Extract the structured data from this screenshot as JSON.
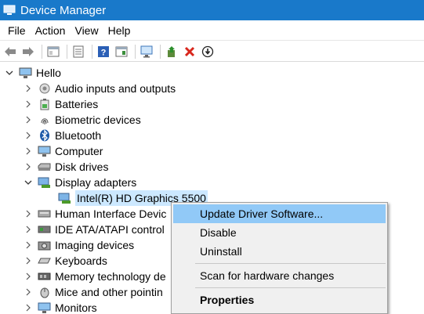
{
  "window": {
    "title": "Device Manager"
  },
  "menu": [
    "File",
    "Action",
    "View",
    "Help"
  ],
  "toolbar": [
    {
      "icon": "back-arrow-icon"
    },
    {
      "icon": "forward-arrow-icon"
    },
    {
      "icon": "show-hide-console-tree-icon"
    },
    {
      "icon": "properties-icon"
    },
    {
      "icon": "help-icon"
    },
    {
      "icon": "show-action-pane-icon"
    },
    {
      "icon": "scan-hardware-icon"
    },
    {
      "icon": "update-driver-icon"
    },
    {
      "icon": "uninstall-x-icon"
    },
    {
      "icon": "disable-device-icon"
    }
  ],
  "tree": {
    "root": "Hello",
    "categories": [
      {
        "label": "Audio inputs and outputs",
        "icon": "speaker-icon",
        "expanded": false
      },
      {
        "label": "Batteries",
        "icon": "battery-icon",
        "expanded": false
      },
      {
        "label": "Biometric devices",
        "icon": "fingerprint-icon",
        "expanded": false
      },
      {
        "label": "Bluetooth",
        "icon": "bluetooth-icon",
        "expanded": false
      },
      {
        "label": "Computer",
        "icon": "computer-icon",
        "expanded": false
      },
      {
        "label": "Disk drives",
        "icon": "disk-drive-icon",
        "expanded": false
      },
      {
        "label": "Display adapters",
        "icon": "display-adapter-icon",
        "expanded": true
      },
      {
        "label": "Intel(R) HD Graphics 5500",
        "icon": "display-adapter-icon",
        "child": true
      },
      {
        "label": "Human Interface Devic",
        "icon": "hid-icon",
        "expanded": false
      },
      {
        "label": "IDE ATA/ATAPI control",
        "icon": "ide-controller-icon",
        "expanded": false
      },
      {
        "label": "Imaging devices",
        "icon": "camera-icon",
        "expanded": false
      },
      {
        "label": "Keyboards",
        "icon": "keyboard-icon",
        "expanded": false
      },
      {
        "label": "Memory technology de",
        "icon": "memory-icon",
        "expanded": false
      },
      {
        "label": "Mice and other pointin",
        "icon": "mouse-icon",
        "expanded": false
      },
      {
        "label": "Monitors",
        "icon": "monitor-icon",
        "expanded": false
      }
    ]
  },
  "context_menu": {
    "items": [
      {
        "label": "Update Driver Software...",
        "highlighted": true
      },
      {
        "label": "Disable"
      },
      {
        "label": "Uninstall"
      },
      {
        "separator": true
      },
      {
        "label": "Scan for hardware changes"
      },
      {
        "separator": true
      },
      {
        "label": "Properties",
        "bold": true
      }
    ]
  },
  "colors": {
    "titlebar": "#1979ca",
    "selection": "#cce8ff",
    "menu_highlight": "#91c9f7"
  }
}
